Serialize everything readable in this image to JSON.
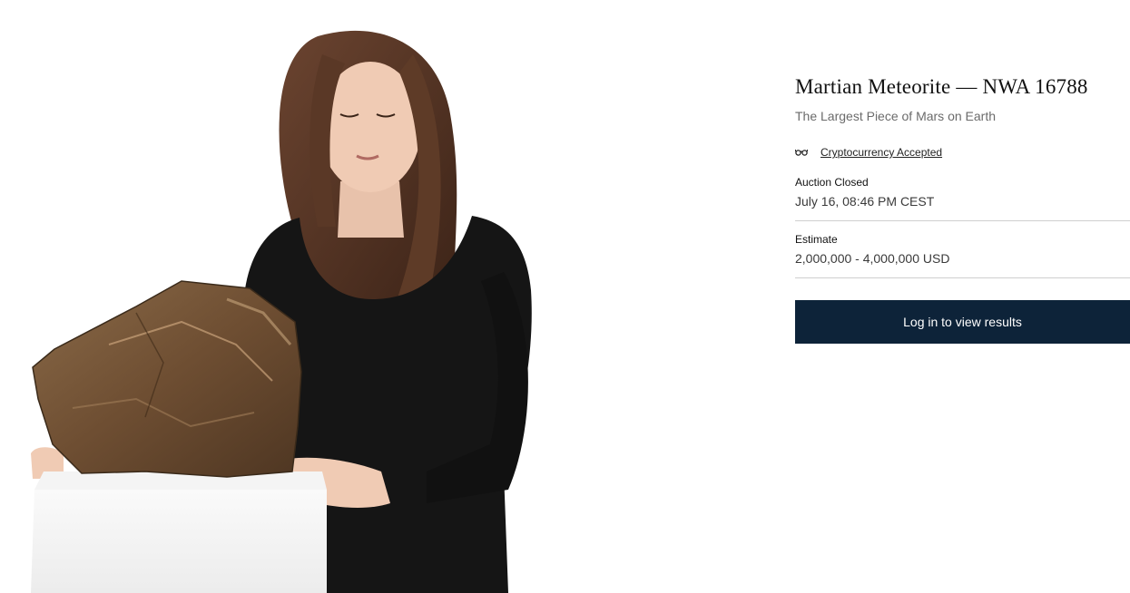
{
  "lot": {
    "title": "Martian Meteorite — NWA 16788",
    "subtitle": "The Largest Piece of Mars on Earth"
  },
  "crypto": {
    "icon": "eyeglasses-icon",
    "label": "Cryptocurrency Accepted"
  },
  "auction": {
    "status_label": "Auction Closed",
    "closed_at": "July 16, 08:46 PM CEST"
  },
  "estimate": {
    "label": "Estimate",
    "value": "2,000,000 - 4,000,000 USD"
  },
  "cta": {
    "login_label": "Log in to view results"
  },
  "colors": {
    "button_bg": "#0d2339",
    "text_primary": "#111111",
    "text_muted": "#6b6b6b"
  }
}
